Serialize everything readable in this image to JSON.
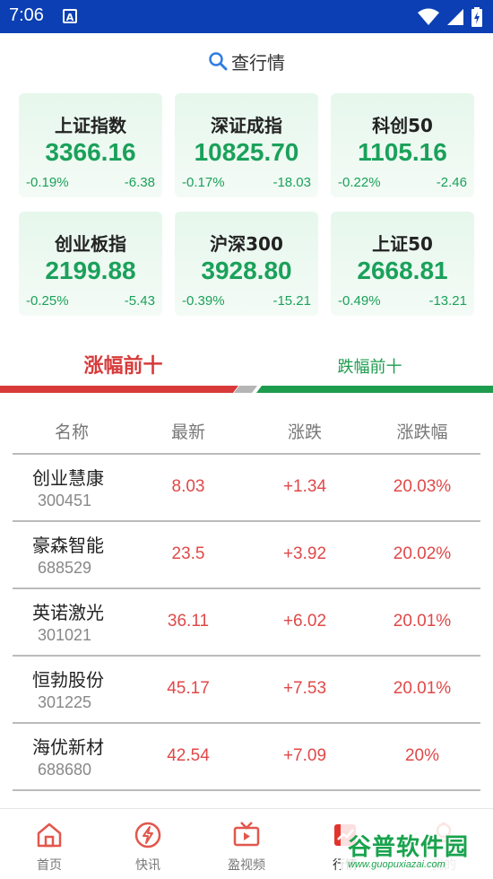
{
  "status_bar": {
    "time": "7:06",
    "notif_glyph": "A"
  },
  "search": {
    "label": "查行情",
    "icon": "search-icon"
  },
  "indices": [
    {
      "name": "上证指数",
      "value": "3366.16",
      "pct": "-0.19%",
      "change": "-6.38"
    },
    {
      "name": "深证成指",
      "value": "10825.70",
      "pct": "-0.17%",
      "change": "-18.03"
    },
    {
      "name": "科创50",
      "value": "1105.16",
      "pct": "-0.22%",
      "change": "-2.46"
    },
    {
      "name": "创业板指",
      "value": "2199.88",
      "pct": "-0.25%",
      "change": "-5.43"
    },
    {
      "name": "沪深300",
      "value": "3928.80",
      "pct": "-0.39%",
      "change": "-15.21"
    },
    {
      "name": "上证50",
      "value": "2668.81",
      "pct": "-0.49%",
      "change": "-13.21"
    }
  ],
  "tabs": {
    "up": "涨幅前十",
    "down": "跌幅前十"
  },
  "table": {
    "headers": [
      "名称",
      "最新",
      "涨跌",
      "涨跌幅"
    ],
    "rows": [
      {
        "name": "创业慧康",
        "code": "300451",
        "latest": "8.03",
        "change": "+1.34",
        "pct": "20.03%"
      },
      {
        "name": "豪森智能",
        "code": "688529",
        "latest": "23.5",
        "change": "+3.92",
        "pct": "20.02%"
      },
      {
        "name": "英诺激光",
        "code": "301021",
        "latest": "36.11",
        "change": "+6.02",
        "pct": "20.01%"
      },
      {
        "name": "恒勃股份",
        "code": "301225",
        "latest": "45.17",
        "change": "+7.53",
        "pct": "20.01%"
      },
      {
        "name": "海优新材",
        "code": "688680",
        "latest": "42.54",
        "change": "+7.09",
        "pct": "20%"
      }
    ]
  },
  "bottom_nav": [
    {
      "label": "首页",
      "icon": "home-icon"
    },
    {
      "label": "快讯",
      "icon": "lightning-icon"
    },
    {
      "label": "盈视频",
      "icon": "tv-icon"
    },
    {
      "label": "行情",
      "icon": "market-icon"
    },
    {
      "label": "我的",
      "icon": "user-icon"
    }
  ],
  "watermark": {
    "title": "谷普软件园",
    "url": "www.guopuxiazai.com"
  },
  "colors": {
    "status_bar": "#0b3fb3",
    "rise": "#e04848",
    "fall": "#1aa15a",
    "tab_active": "#d83a3a",
    "tab_inactive": "#1e9c4e"
  }
}
